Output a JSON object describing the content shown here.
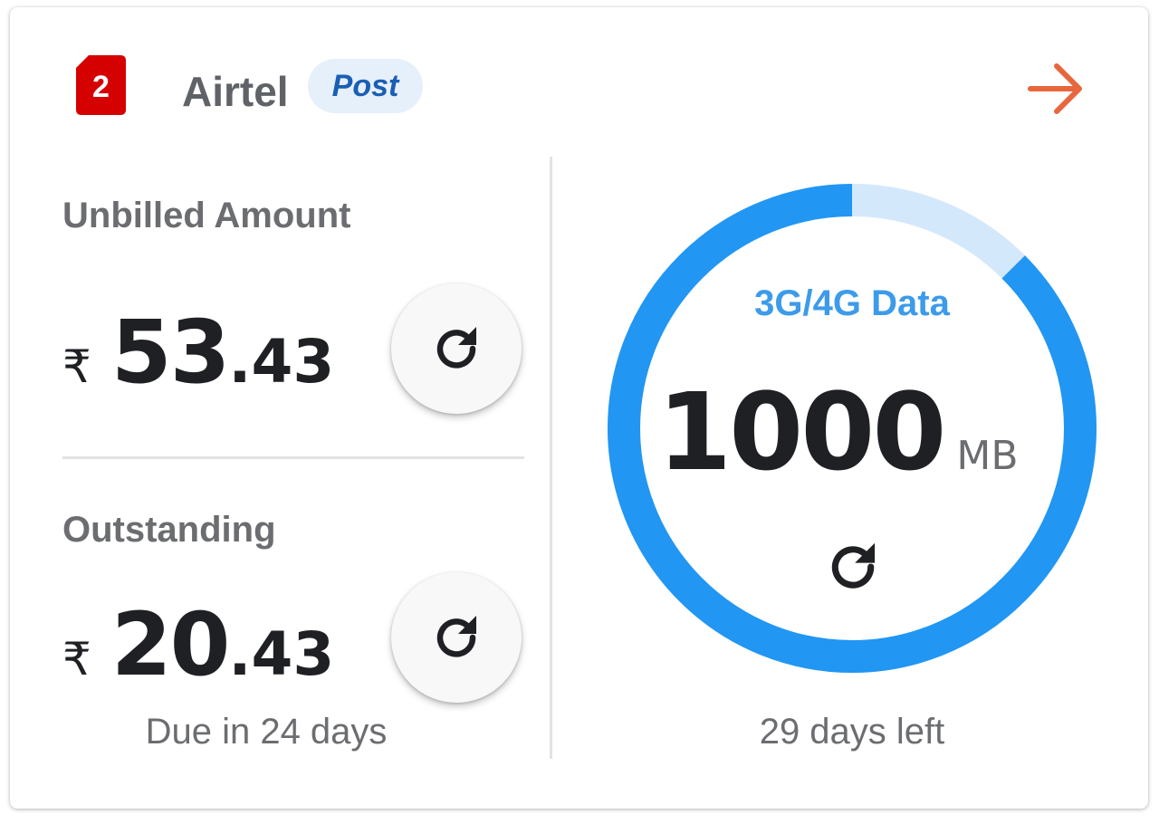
{
  "header": {
    "sim_slot": "2",
    "operator": "Airtel",
    "plan_type": "Post"
  },
  "billing": {
    "unbilled": {
      "label": "Unbilled Amount",
      "currency": "₹",
      "whole": "53",
      "fraction": ".43"
    },
    "outstanding": {
      "label": "Outstanding",
      "currency": "₹",
      "whole": "20",
      "fraction": ".43",
      "due_text": "Due in 24 days"
    }
  },
  "data_usage": {
    "label": "3G/4G Data",
    "value": "1000",
    "unit": "MB",
    "remaining_fraction": 0.875,
    "days_left_text": "29 days left"
  },
  "colors": {
    "sim_badge": "#d50000",
    "arrow": "#e8663d",
    "ring_used": "#2196f3",
    "ring_track": "#d4e8fb",
    "data_label": "#3c9bea"
  },
  "icons": {
    "sim": "sim-card-icon",
    "arrow": "arrow-right-icon",
    "refresh": "refresh-icon"
  }
}
